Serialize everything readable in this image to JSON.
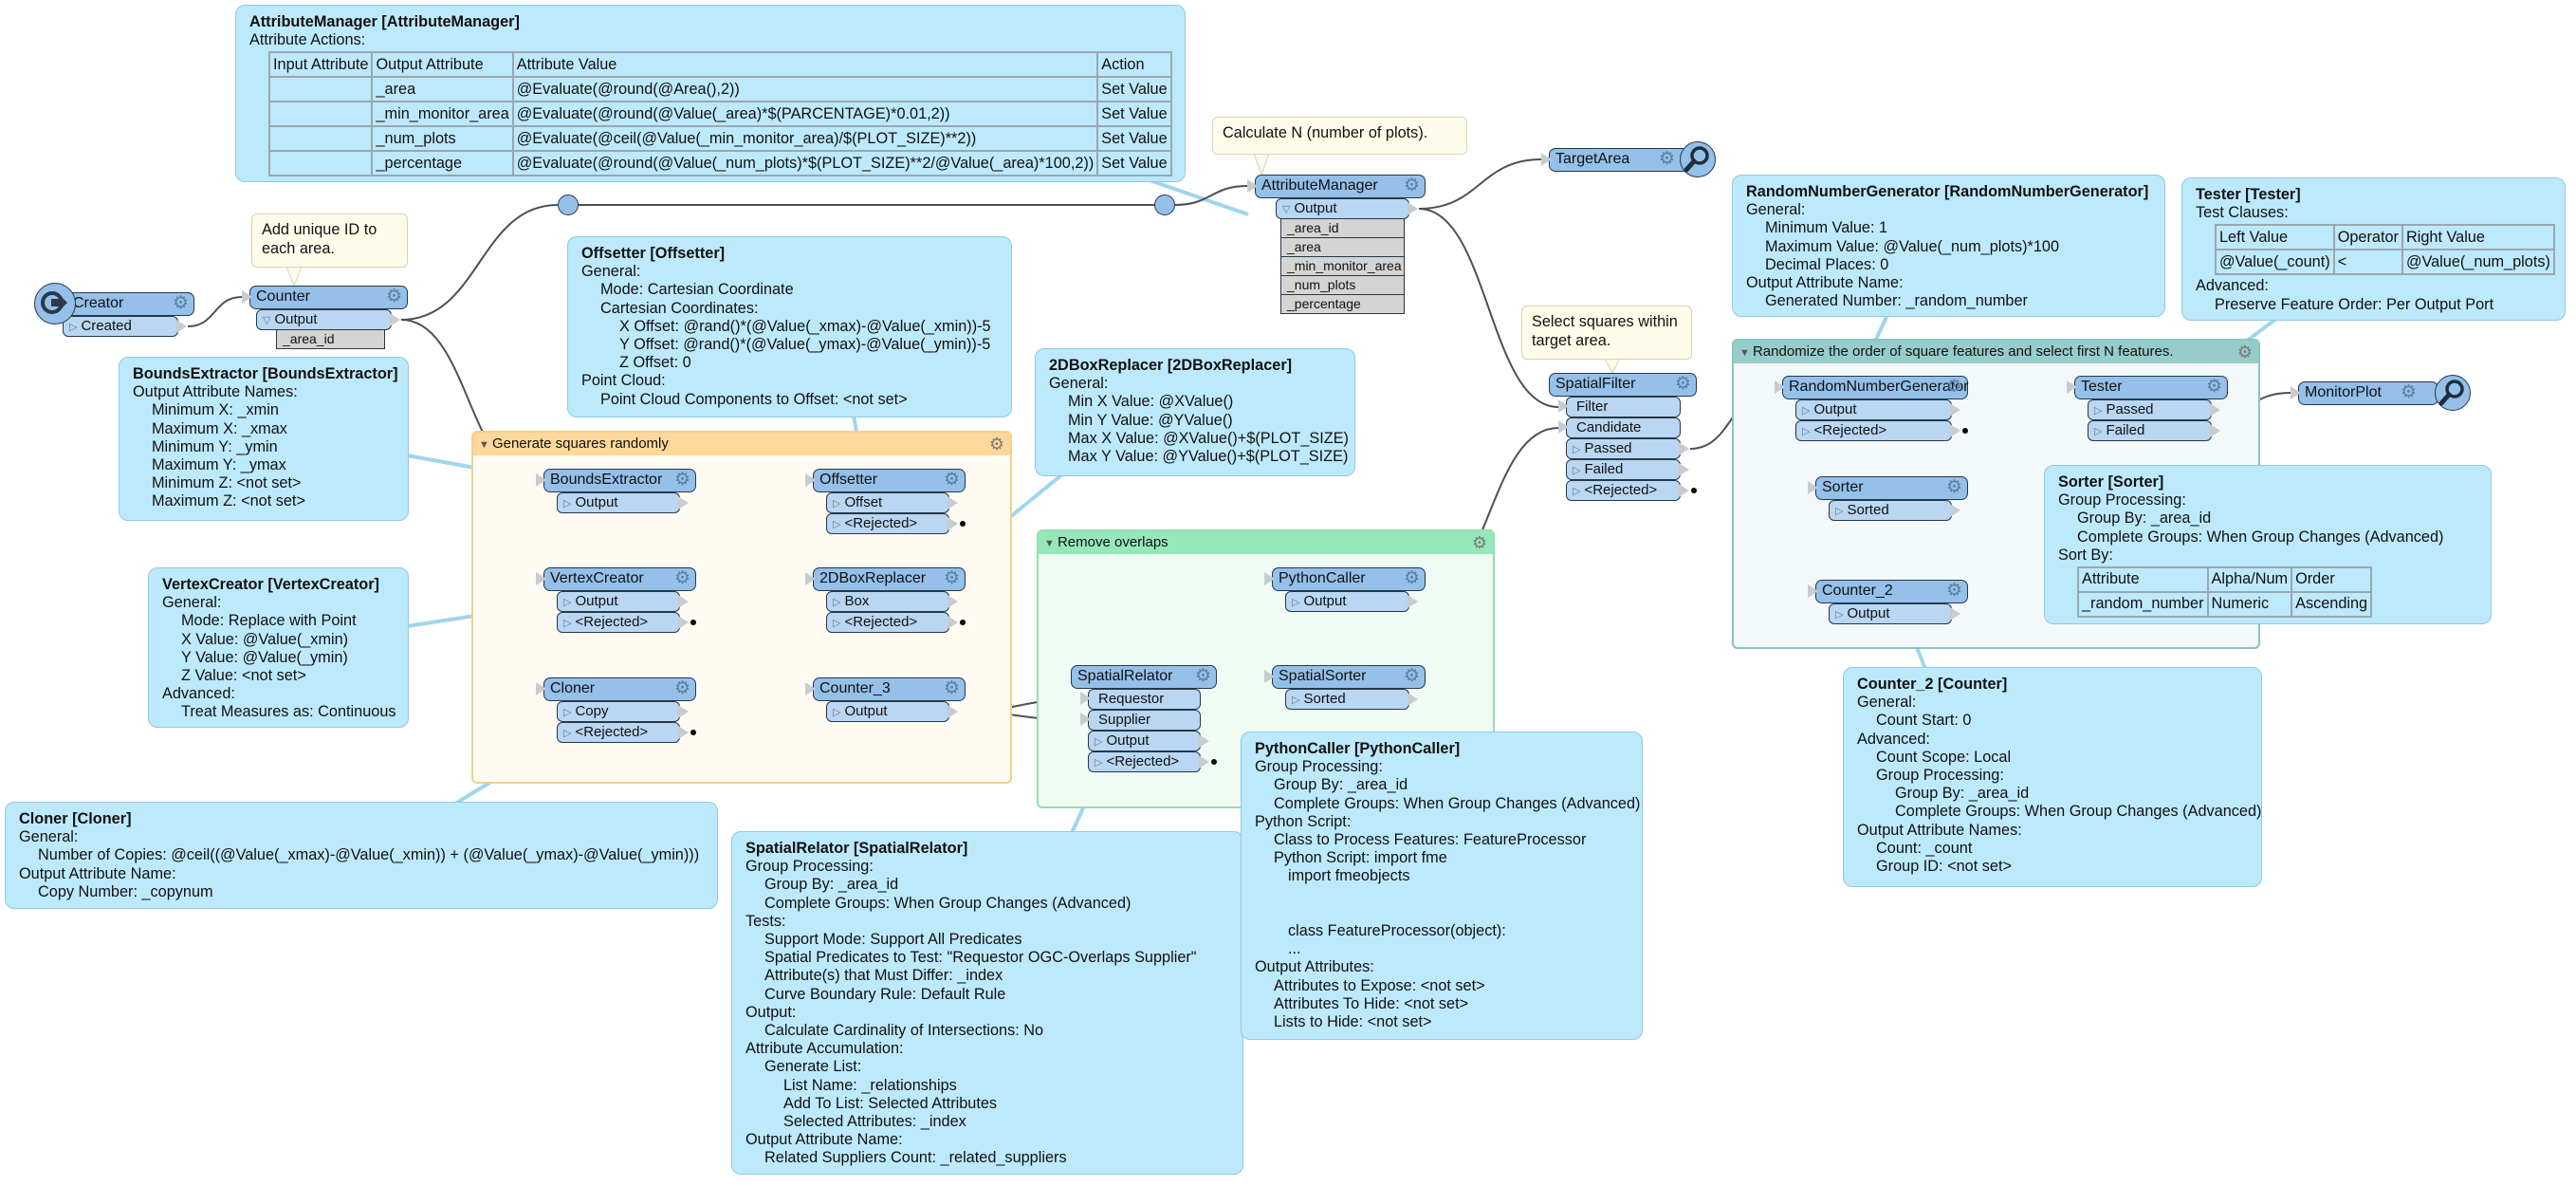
{
  "colors": {
    "transformer_header": "#94c0e9",
    "port": "#b9d6f2",
    "annotation": "#bde9fc",
    "comment": "#fffcea",
    "bookmark_generate": "#fdd89a",
    "bookmark_overlaps": "#96e8b8",
    "bookmark_randomize": "#96ccca"
  },
  "bookmarks": {
    "generate": {
      "title": "Generate squares randomly",
      "icon": "collapse-triangle-icon"
    },
    "overlaps": {
      "title": "Remove overlaps",
      "icon": "collapse-triangle-icon"
    },
    "randomize": {
      "title": "Randomize the order of square features and select first N features.",
      "icon": "collapse-triangle-icon"
    }
  },
  "comments": {
    "calc_n": {
      "text": "Calculate N (number of plots)."
    },
    "add_id": {
      "text": "Add unique ID to each area."
    },
    "select": {
      "text": "Select squares within target area."
    }
  },
  "transformers": {
    "creator": {
      "name": "Creator",
      "ports": [
        {
          "label": "Created",
          "dir": "out"
        }
      ]
    },
    "counter": {
      "name": "Counter",
      "ports": [
        {
          "label": "Output",
          "dir": "out",
          "expanded": true
        }
      ],
      "attrs": [
        "_area_id"
      ]
    },
    "attributemanager": {
      "name": "AttributeManager",
      "ports": [
        {
          "label": "Output",
          "dir": "out",
          "expanded": true
        }
      ],
      "attrs": [
        "_area_id",
        "_area",
        "_min_monitor_area",
        "_num_plots",
        "_percentage"
      ]
    },
    "targetarea": {
      "name": "TargetArea",
      "ports": []
    },
    "spatialfilter": {
      "name": "SpatialFilter",
      "noinput": true,
      "ports": [
        {
          "label": "Filter",
          "dir": "in"
        },
        {
          "label": "Candidate",
          "dir": "in"
        },
        {
          "label": "Passed",
          "dir": "out"
        },
        {
          "label": "Failed",
          "dir": "out"
        },
        {
          "label": "<Rejected>",
          "dir": "out",
          "rejected": true
        }
      ]
    },
    "boundsextractor": {
      "name": "BoundsExtractor",
      "ports": [
        {
          "label": "Output",
          "dir": "out"
        }
      ]
    },
    "vertexcreator": {
      "name": "VertexCreator",
      "ports": [
        {
          "label": "Output",
          "dir": "out"
        },
        {
          "label": "<Rejected>",
          "dir": "out",
          "rejected": true
        }
      ]
    },
    "cloner": {
      "name": "Cloner",
      "ports": [
        {
          "label": "Copy",
          "dir": "out"
        },
        {
          "label": "<Rejected>",
          "dir": "out",
          "rejected": true
        }
      ]
    },
    "offsetter": {
      "name": "Offsetter",
      "ports": [
        {
          "label": "Offset",
          "dir": "out"
        },
        {
          "label": "<Rejected>",
          "dir": "out",
          "rejected": true
        }
      ]
    },
    "boxreplacer": {
      "name": "2DBoxReplacer",
      "ports": [
        {
          "label": "Box",
          "dir": "out"
        },
        {
          "label": "<Rejected>",
          "dir": "out",
          "rejected": true
        }
      ]
    },
    "counter3": {
      "name": "Counter_3",
      "ports": [
        {
          "label": "Output",
          "dir": "out"
        }
      ]
    },
    "spatialrelator": {
      "name": "SpatialRelator",
      "noinput": true,
      "ports": [
        {
          "label": "Requestor",
          "dir": "in"
        },
        {
          "label": "Supplier",
          "dir": "in"
        },
        {
          "label": "Output",
          "dir": "out"
        },
        {
          "label": "<Rejected>",
          "dir": "out",
          "rejected": true
        }
      ]
    },
    "pythoncaller": {
      "name": "PythonCaller",
      "ports": [
        {
          "label": "Output",
          "dir": "out"
        }
      ]
    },
    "spatialsorter": {
      "name": "SpatialSorter",
      "ports": [
        {
          "label": "Sorted",
          "dir": "out"
        }
      ]
    },
    "rng": {
      "name": "RandomNumberGenerator",
      "ports": [
        {
          "label": "Output",
          "dir": "out"
        },
        {
          "label": "<Rejected>",
          "dir": "out",
          "rejected": true
        }
      ]
    },
    "sorter": {
      "name": "Sorter",
      "ports": [
        {
          "label": "Sorted",
          "dir": "out"
        }
      ]
    },
    "counter2": {
      "name": "Counter_2",
      "ports": [
        {
          "label": "Output",
          "dir": "out"
        }
      ]
    },
    "tester": {
      "name": "Tester",
      "ports": [
        {
          "label": "Passed",
          "dir": "out"
        },
        {
          "label": "Failed",
          "dir": "out"
        }
      ]
    },
    "monitorplot": {
      "name": "MonitorPlot",
      "ports": []
    }
  },
  "annotations": {
    "attrmgr": {
      "title": "AttributeManager [AttributeManager]",
      "lines": [
        {
          "t": "Attribute Actions:",
          "i": 0
        },
        {
          "table": [
            [
              "Input Attribute",
              "Output Attribute",
              "Attribute Value",
              "Action"
            ],
            [
              "",
              "_area",
              "@Evaluate(@round(@Area(),2))",
              "Set Value"
            ],
            [
              "",
              "_min_monitor_area",
              "@Evaluate(@round(@Value(_area)*$(PARCENTAGE)*0.01,2))",
              "Set Value"
            ],
            [
              "",
              "_num_plots",
              "@Evaluate(@ceil(@Value(_min_monitor_area)/$(PLOT_SIZE)**2))",
              "Set Value"
            ],
            [
              "",
              "_percentage",
              "@Evaluate(@round(@Value(_num_plots)*$(PLOT_SIZE)**2/@Value(_area)*100,2))",
              "Set Value"
            ]
          ]
        }
      ]
    },
    "offsetter": {
      "title": "Offsetter [Offsetter]",
      "lines": [
        {
          "t": "General:",
          "i": 0
        },
        {
          "t": "Mode: Cartesian Coordinate",
          "i": 1
        },
        {
          "t": "Cartesian Coordinates:",
          "i": 1
        },
        {
          "t": "X Offset: @rand()*(@Value(_xmax)-@Value(_xmin))-5",
          "i": 2
        },
        {
          "t": "Y Offset: @rand()*(@Value(_ymax)-@Value(_ymin))-5",
          "i": 2
        },
        {
          "t": "Z Offset: 0",
          "i": 2
        },
        {
          "t": "Point Cloud:",
          "i": 0
        },
        {
          "t": "Point Cloud Components to Offset: <not set>",
          "i": 1
        }
      ]
    },
    "bounds": {
      "title": "BoundsExtractor [BoundsExtractor]",
      "lines": [
        {
          "t": "Output Attribute Names:",
          "i": 0
        },
        {
          "t": "Minimum X: _xmin",
          "i": 1
        },
        {
          "t": "Maximum X: _xmax",
          "i": 1
        },
        {
          "t": "Minimum Y: _ymin",
          "i": 1
        },
        {
          "t": "Maximum Y: _ymax",
          "i": 1
        },
        {
          "t": "Minimum Z: <not set>",
          "i": 1
        },
        {
          "t": "Maximum Z: <not set>",
          "i": 1
        }
      ]
    },
    "boxreplacer": {
      "title": "2DBoxReplacer [2DBoxReplacer]",
      "lines": [
        {
          "t": "General:",
          "i": 0
        },
        {
          "t": "Min X Value: @XValue()",
          "i": 1
        },
        {
          "t": "Min Y Value: @YValue()",
          "i": 1
        },
        {
          "t": "Max X Value: @XValue()+$(PLOT_SIZE)",
          "i": 1
        },
        {
          "t": "Max Y Value: @YValue()+$(PLOT_SIZE)",
          "i": 1
        }
      ]
    },
    "vertex": {
      "title": "VertexCreator [VertexCreator]",
      "lines": [
        {
          "t": "General:",
          "i": 0
        },
        {
          "t": "Mode: Replace with Point",
          "i": 1
        },
        {
          "t": "X Value: @Value(_xmin)",
          "i": 1
        },
        {
          "t": "Y Value: @Value(_ymin)",
          "i": 1
        },
        {
          "t": "Z Value: <not set>",
          "i": 1
        },
        {
          "t": "Advanced:",
          "i": 0
        },
        {
          "t": "Treat Measures as: Continuous",
          "i": 1
        }
      ]
    },
    "cloner": {
      "title": "Cloner [Cloner]",
      "lines": [
        {
          "t": "General:",
          "i": 0
        },
        {
          "t": "Number of Copies: @ceil((@Value(_xmax)-@Value(_xmin)) + (@Value(_ymax)-@Value(_ymin)))",
          "i": 1
        },
        {
          "t": "Output Attribute Name:",
          "i": 0
        },
        {
          "t": "Copy Number: _copynum",
          "i": 1
        }
      ]
    },
    "relator": {
      "title": "SpatialRelator [SpatialRelator]",
      "lines": [
        {
          "t": "Group Processing:",
          "i": 0
        },
        {
          "t": "Group By: _area_id",
          "i": 1
        },
        {
          "t": "Complete Groups: When Group Changes (Advanced)",
          "i": 1
        },
        {
          "t": "Tests:",
          "i": 0
        },
        {
          "t": "Support Mode: Support All Predicates",
          "i": 1
        },
        {
          "t": "Spatial Predicates to Test: \"Requestor OGC-Overlaps Supplier\"",
          "i": 1
        },
        {
          "t": "Attribute(s) that Must Differ: _index",
          "i": 1
        },
        {
          "t": "Curve Boundary Rule: Default Rule",
          "i": 1
        },
        {
          "t": "Output:",
          "i": 0
        },
        {
          "t": "Calculate Cardinality of Intersections: No",
          "i": 1
        },
        {
          "t": "Attribute Accumulation:",
          "i": 0
        },
        {
          "t": "Generate List:",
          "i": 1
        },
        {
          "t": "List Name: _relationships",
          "i": 2
        },
        {
          "t": "Add To List: Selected Attributes",
          "i": 2
        },
        {
          "t": "Selected Attributes: _index",
          "i": 2
        },
        {
          "t": "Output Attribute Name:",
          "i": 0
        },
        {
          "t": "Related Suppliers Count: _related_suppliers",
          "i": 1
        }
      ]
    },
    "python": {
      "title": "PythonCaller [PythonCaller]",
      "lines": [
        {
          "t": "Group Processing:",
          "i": 0
        },
        {
          "t": "Group By: _area_id",
          "i": 1
        },
        {
          "t": "Complete Groups: When Group Changes (Advanced)",
          "i": 1
        },
        {
          "t": "Python Script:",
          "i": 0
        },
        {
          "t": "Class to Process Features: FeatureProcessor",
          "i": 1
        },
        {
          "t": "Python Script: import fme",
          "i": 1
        },
        {
          "t": "import fmeobjects",
          "i": 1.75
        },
        {
          "t": "",
          "i": 0
        },
        {
          "t": "",
          "i": 0
        },
        {
          "t": "class FeatureProcessor(object):",
          "i": 1.75
        },
        {
          "t": "...",
          "i": 1.75
        },
        {
          "t": "Output Attributes:",
          "i": 0
        },
        {
          "t": "Attributes to Expose: <not set>",
          "i": 1
        },
        {
          "t": "Attributes To Hide: <not set>",
          "i": 1
        },
        {
          "t": "Lists to Hide: <not set>",
          "i": 1
        }
      ]
    },
    "rng": {
      "title": "RandomNumberGenerator [RandomNumberGenerator]",
      "lines": [
        {
          "t": "General:",
          "i": 0
        },
        {
          "t": "Minimum Value: 1",
          "i": 1
        },
        {
          "t": "Maximum Value: @Value(_num_plots)*100",
          "i": 1
        },
        {
          "t": "Decimal Places: 0",
          "i": 1
        },
        {
          "t": "Output Attribute Name:",
          "i": 0
        },
        {
          "t": "Generated Number: _random_number",
          "i": 1
        }
      ]
    },
    "tester": {
      "title": "Tester [Tester]",
      "lines": [
        {
          "t": "Test Clauses:",
          "i": 0
        },
        {
          "table": [
            [
              "Left Value",
              "Operator",
              "Right Value"
            ],
            [
              "@Value(_count)",
              "<",
              "@Value(_num_plots)"
            ]
          ]
        },
        {
          "t": "Advanced:",
          "i": 0
        },
        {
          "t": "Preserve Feature Order: Per Output Port",
          "i": 1
        }
      ]
    },
    "sorter": {
      "title": "Sorter [Sorter]",
      "lines": [
        {
          "t": "Group Processing:",
          "i": 0
        },
        {
          "t": "Group By: _area_id",
          "i": 1
        },
        {
          "t": "Complete Groups: When Group Changes (Advanced)",
          "i": 1
        },
        {
          "t": "Sort By:",
          "i": 0
        },
        {
          "table": [
            [
              "Attribute",
              "Alpha/Num",
              "Order"
            ],
            [
              "_random_number",
              "Numeric",
              "Ascending"
            ]
          ]
        }
      ]
    },
    "counter2": {
      "title": "Counter_2 [Counter]",
      "lines": [
        {
          "t": "General:",
          "i": 0
        },
        {
          "t": "Count Start: 0",
          "i": 1
        },
        {
          "t": "Advanced:",
          "i": 0
        },
        {
          "t": "Count Scope: Local",
          "i": 1
        },
        {
          "t": "Group Processing:",
          "i": 1
        },
        {
          "t": "Group By: _area_id",
          "i": 2
        },
        {
          "t": "Complete Groups: When Group Changes (Advanced)",
          "i": 2
        },
        {
          "t": "Output Attribute Names:",
          "i": 0
        },
        {
          "t": "Count: _count",
          "i": 1
        },
        {
          "t": "Group ID: <not set>",
          "i": 1
        }
      ]
    }
  }
}
